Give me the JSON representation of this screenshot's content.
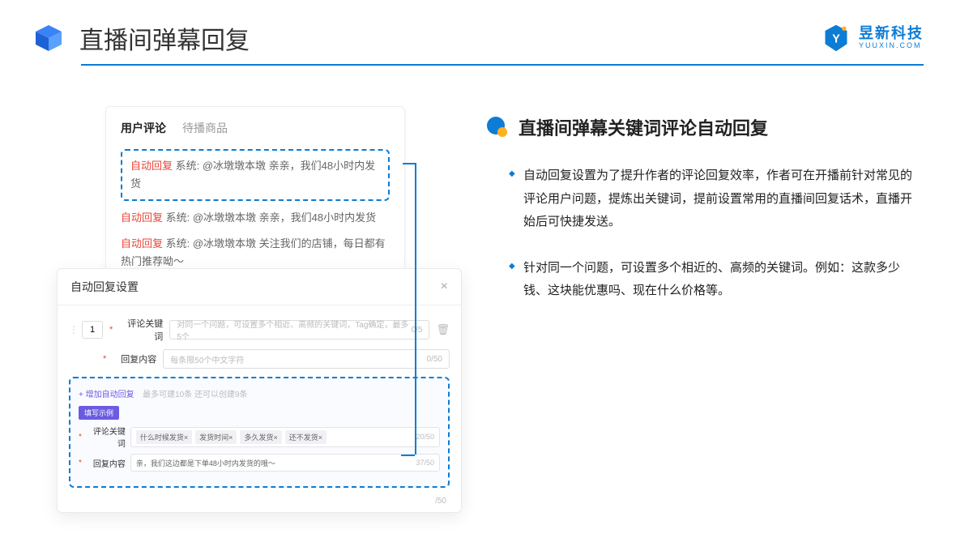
{
  "header": {
    "title": "直播间弹幕回复"
  },
  "brand": {
    "name": "昱新科技",
    "domain": "YUUXIN.COM"
  },
  "comments": {
    "tab_active": "用户评论",
    "tab_inactive": "待播商品",
    "rows": [
      {
        "tag": "自动回复",
        "text": "系统: @冰墩墩本墩 亲亲，我们48小时内发货"
      },
      {
        "tag": "自动回复",
        "text": "系统: @冰墩墩本墩 亲亲，我们48小时内发货"
      },
      {
        "tag": "自动回复",
        "text": "系统: @冰墩墩本墩 关注我们的店铺，每日都有热门推荐呦～"
      }
    ]
  },
  "settings": {
    "title": "自动回复设置",
    "order": "1",
    "keyword_label": "评论关键词",
    "keyword_placeholder": "对同一个问题，可设置多个相近、高频的关键词，Tag确定，最多5个",
    "keyword_counter": "0/5",
    "content_label": "回复内容",
    "content_placeholder": "每条限50个中文字符",
    "content_counter": "0/50",
    "add_link": "+ 增加自动回复",
    "add_hint": "最多可建10条 还可以创建9条",
    "badge": "填写示例",
    "ex_keyword_label": "评论关键词",
    "ex_chips": [
      "什么时候发货×",
      "发货时间×",
      "多久发货×",
      "还不发货×"
    ],
    "ex_keyword_counter": "20/50",
    "ex_content_label": "回复内容",
    "ex_content_text": "亲，我们这边都是下单48小时内发货的哦～",
    "ex_content_counter": "37/50",
    "outer_counter": "/50"
  },
  "right": {
    "title": "直播间弹幕关键词评论自动回复",
    "bullets": [
      "自动回复设置为了提升作者的评论回复效率，作者可在开播前针对常见的评论用户问题，提炼出关键词，提前设置常用的直播间回复话术，直播开始后可快捷发送。",
      "针对同一个问题，可设置多个相近的、高频的关键词。例如：这款多少钱、这块能优惠吗、现在什么价格等。"
    ]
  }
}
